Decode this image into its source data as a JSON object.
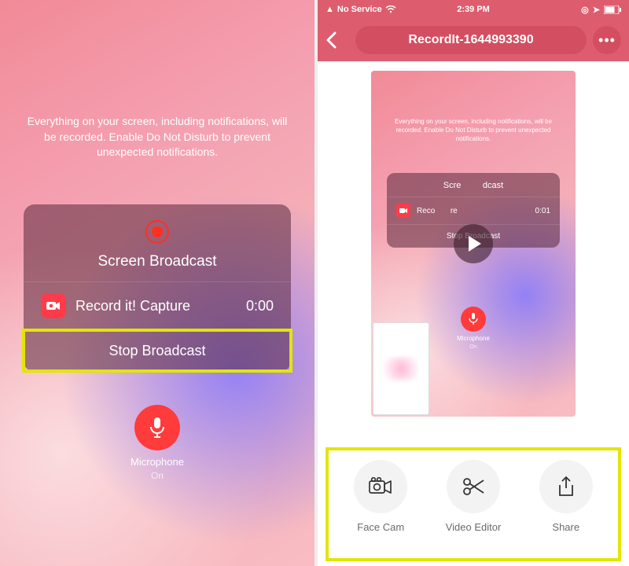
{
  "left": {
    "info_text": "Everything on your screen, including notifications, will be recorded. Enable Do Not Disturb to prevent unexpected notifications.",
    "modal": {
      "title": "Screen Broadcast",
      "app_name": "Record it! Capture",
      "timer": "0:00",
      "stop_label": "Stop Broadcast"
    },
    "mic": {
      "label": "Microphone",
      "status": "On"
    }
  },
  "right": {
    "status": {
      "service": "No Service",
      "time": "2:39 PM"
    },
    "header": {
      "title": "RecordIt-1644993390"
    },
    "preview": {
      "info_text": "Everything on your screen, including notifications, will be recorded. Enable Do Not Disturb to prevent unexpected notifications.",
      "modal": {
        "title_left": "Scre",
        "title_right": "dcast",
        "app_left": "Reco",
        "app_right": "re",
        "timer": "0:01",
        "stop_label": "Stop Broadcast"
      },
      "mic": {
        "label": "Microphone",
        "status": "On"
      }
    },
    "toolbar": {
      "facecam": "Face Cam",
      "editor": "Video Editor",
      "share": "Share"
    }
  }
}
